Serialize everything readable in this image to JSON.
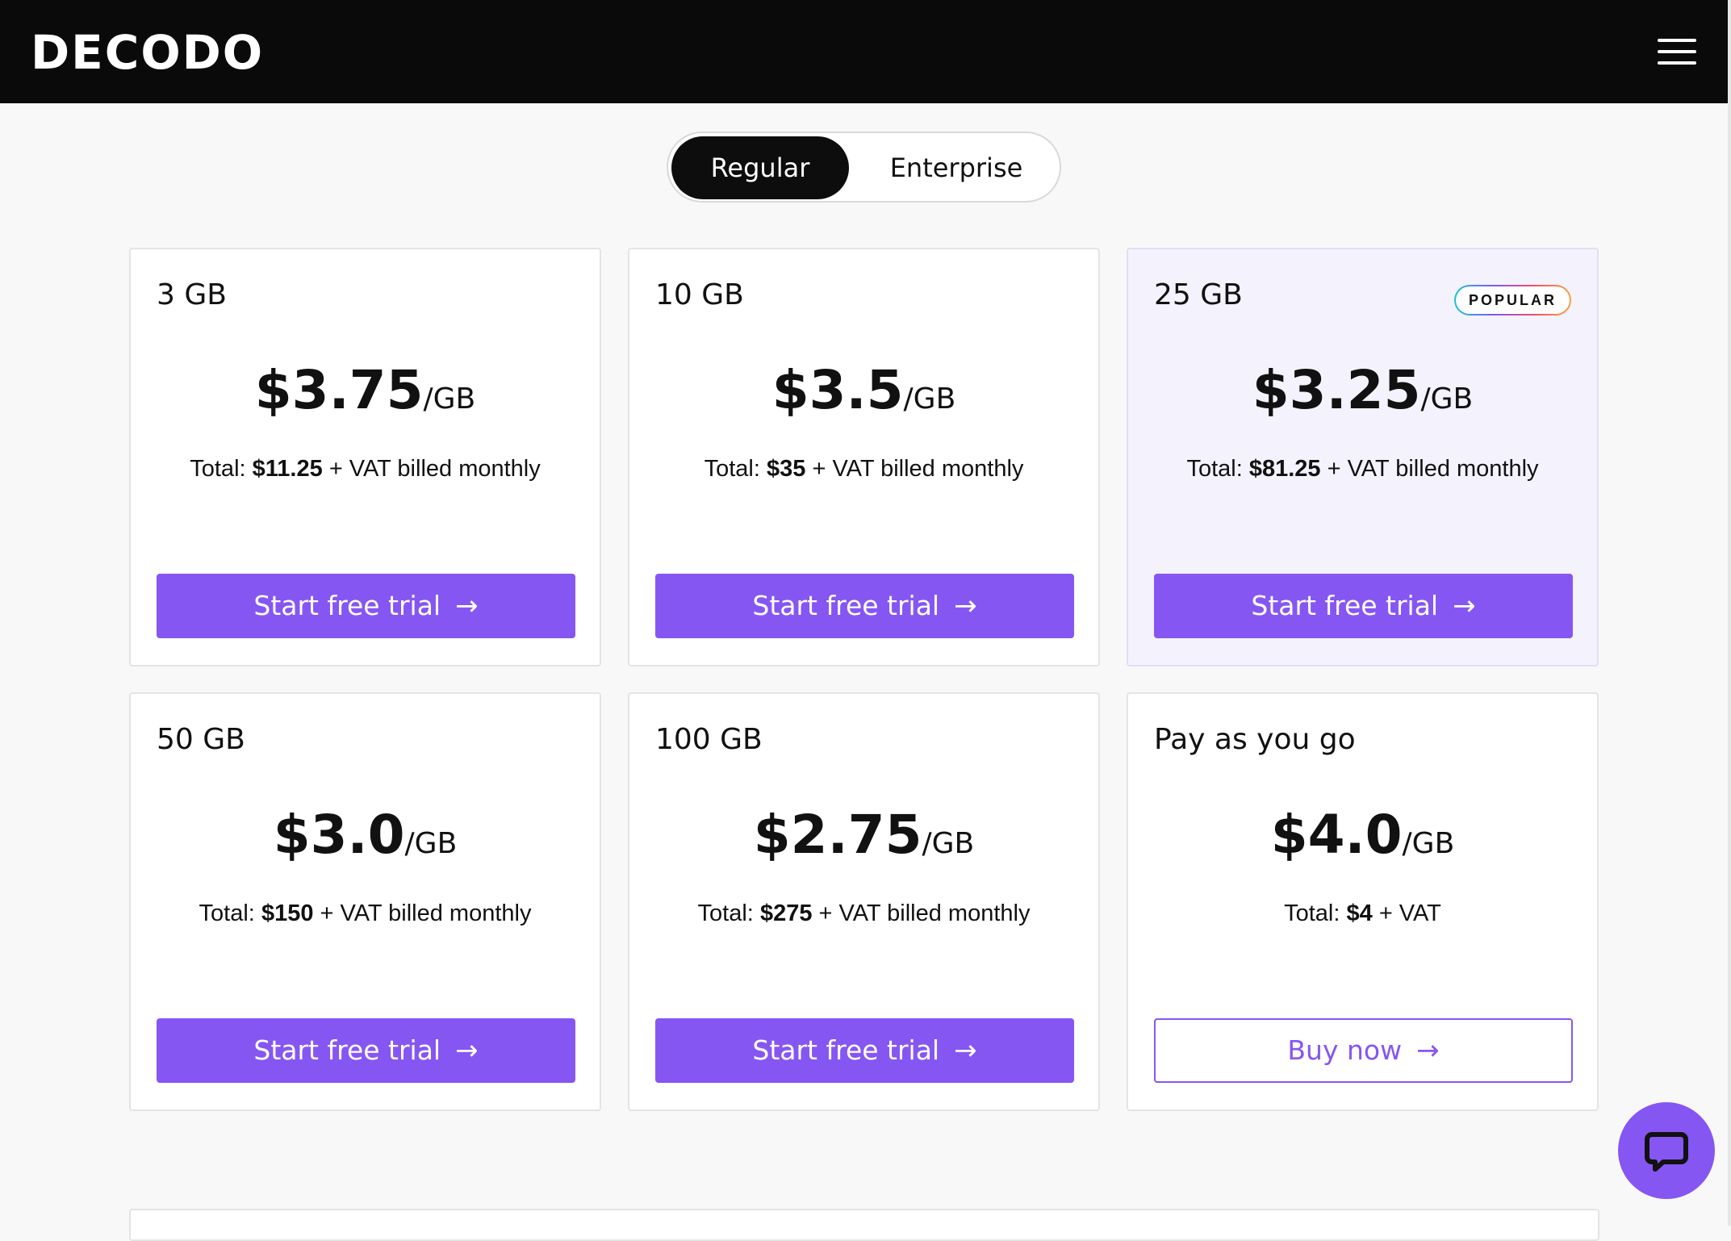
{
  "header": {
    "logo_text": "DECODO",
    "menu_icon": "hamburger-menu-icon"
  },
  "toggle": {
    "options": [
      "Regular",
      "Enterprise"
    ],
    "selected": "Regular"
  },
  "plans": [
    {
      "size": "3 GB",
      "price": "$3.75",
      "unit": "/GB",
      "total_label": "Total:",
      "total_amount": "$11.25",
      "total_suffix": "+ VAT billed monthly",
      "cta": "Start free trial",
      "popular": false
    },
    {
      "size": "10 GB",
      "price": "$3.5",
      "unit": "/GB",
      "total_label": "Total:",
      "total_amount": "$35",
      "total_suffix": "+ VAT billed monthly",
      "cta": "Start free trial",
      "popular": false
    },
    {
      "size": "25 GB",
      "price": "$3.25",
      "unit": "/GB",
      "total_label": "Total:",
      "total_amount": "$81.25",
      "total_suffix": "+ VAT billed monthly",
      "cta": "Start free trial",
      "popular": true,
      "badge": "POPULAR"
    },
    {
      "size": "50 GB",
      "price": "$3.0",
      "unit": "/GB",
      "total_label": "Total:",
      "total_amount": "$150",
      "total_suffix": "+ VAT billed monthly",
      "cta": "Start free trial",
      "popular": false
    },
    {
      "size": "100 GB",
      "price": "$2.75",
      "unit": "/GB",
      "total_label": "Total:",
      "total_amount": "$275",
      "total_suffix": "+ VAT billed monthly",
      "cta": "Start free trial",
      "popular": false
    },
    {
      "size": "Pay as you go",
      "price": "$4.0",
      "unit": "/GB",
      "total_label": "Total:",
      "total_amount": "$4",
      "total_suffix": "+ VAT",
      "cta": "Buy now",
      "popular": false
    }
  ],
  "colors": {
    "accent": "#8656f3",
    "header_bg": "#0a0a0a",
    "highlight_card_bg": "#f4f2fd"
  },
  "chat": {
    "icon": "chat-bubble-icon"
  }
}
